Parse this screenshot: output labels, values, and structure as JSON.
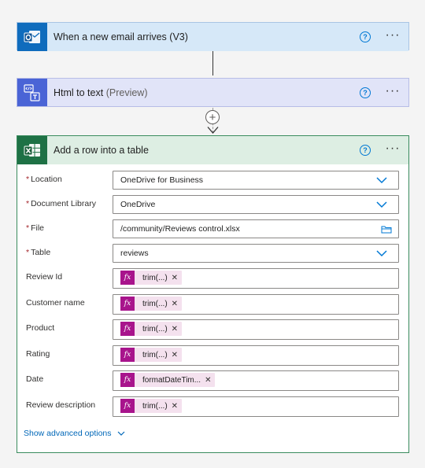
{
  "trigger": {
    "title": "When a new email arrives (V3)",
    "icon": "outlook-icon",
    "help": "?",
    "more": "···"
  },
  "html_to_text": {
    "title": "Html to text",
    "subtitle": "(Preview)",
    "icon": "html-to-text-icon",
    "help": "?",
    "more": "···"
  },
  "insert": {
    "plus": "+"
  },
  "excel": {
    "title": "Add a row into a table",
    "icon": "excel-icon",
    "help": "?",
    "more": "···",
    "required_mark": "*",
    "fields": {
      "location": {
        "label": "Location",
        "value": "OneDrive for Business"
      },
      "library": {
        "label": "Document Library",
        "value": "OneDrive"
      },
      "file": {
        "label": "File",
        "value": "/community/Reviews control.xlsx"
      },
      "table": {
        "label": "Table",
        "value": "reviews"
      },
      "review_id": {
        "label": "Review Id",
        "token": "trim(...)"
      },
      "customer_name": {
        "label": "Customer name",
        "token": "trim(...)"
      },
      "product": {
        "label": "Product",
        "token": "trim(...)"
      },
      "rating": {
        "label": "Rating",
        "token": "trim(...)"
      },
      "date": {
        "label": "Date",
        "token": "formatDateTim..."
      },
      "review_description": {
        "label": "Review description",
        "token": "trim(...)"
      }
    },
    "fx": "fx",
    "remove": "✕",
    "advanced_label": "Show advanced options"
  },
  "colors": {
    "accent": "#0078d4",
    "excel_green": "#1e7145",
    "outlook_blue": "#0f6cbd",
    "html_blue": "#4a64d6",
    "token_purple": "#a8148c",
    "token_bg": "#f4e1ee",
    "required_red": "#a4262c"
  }
}
